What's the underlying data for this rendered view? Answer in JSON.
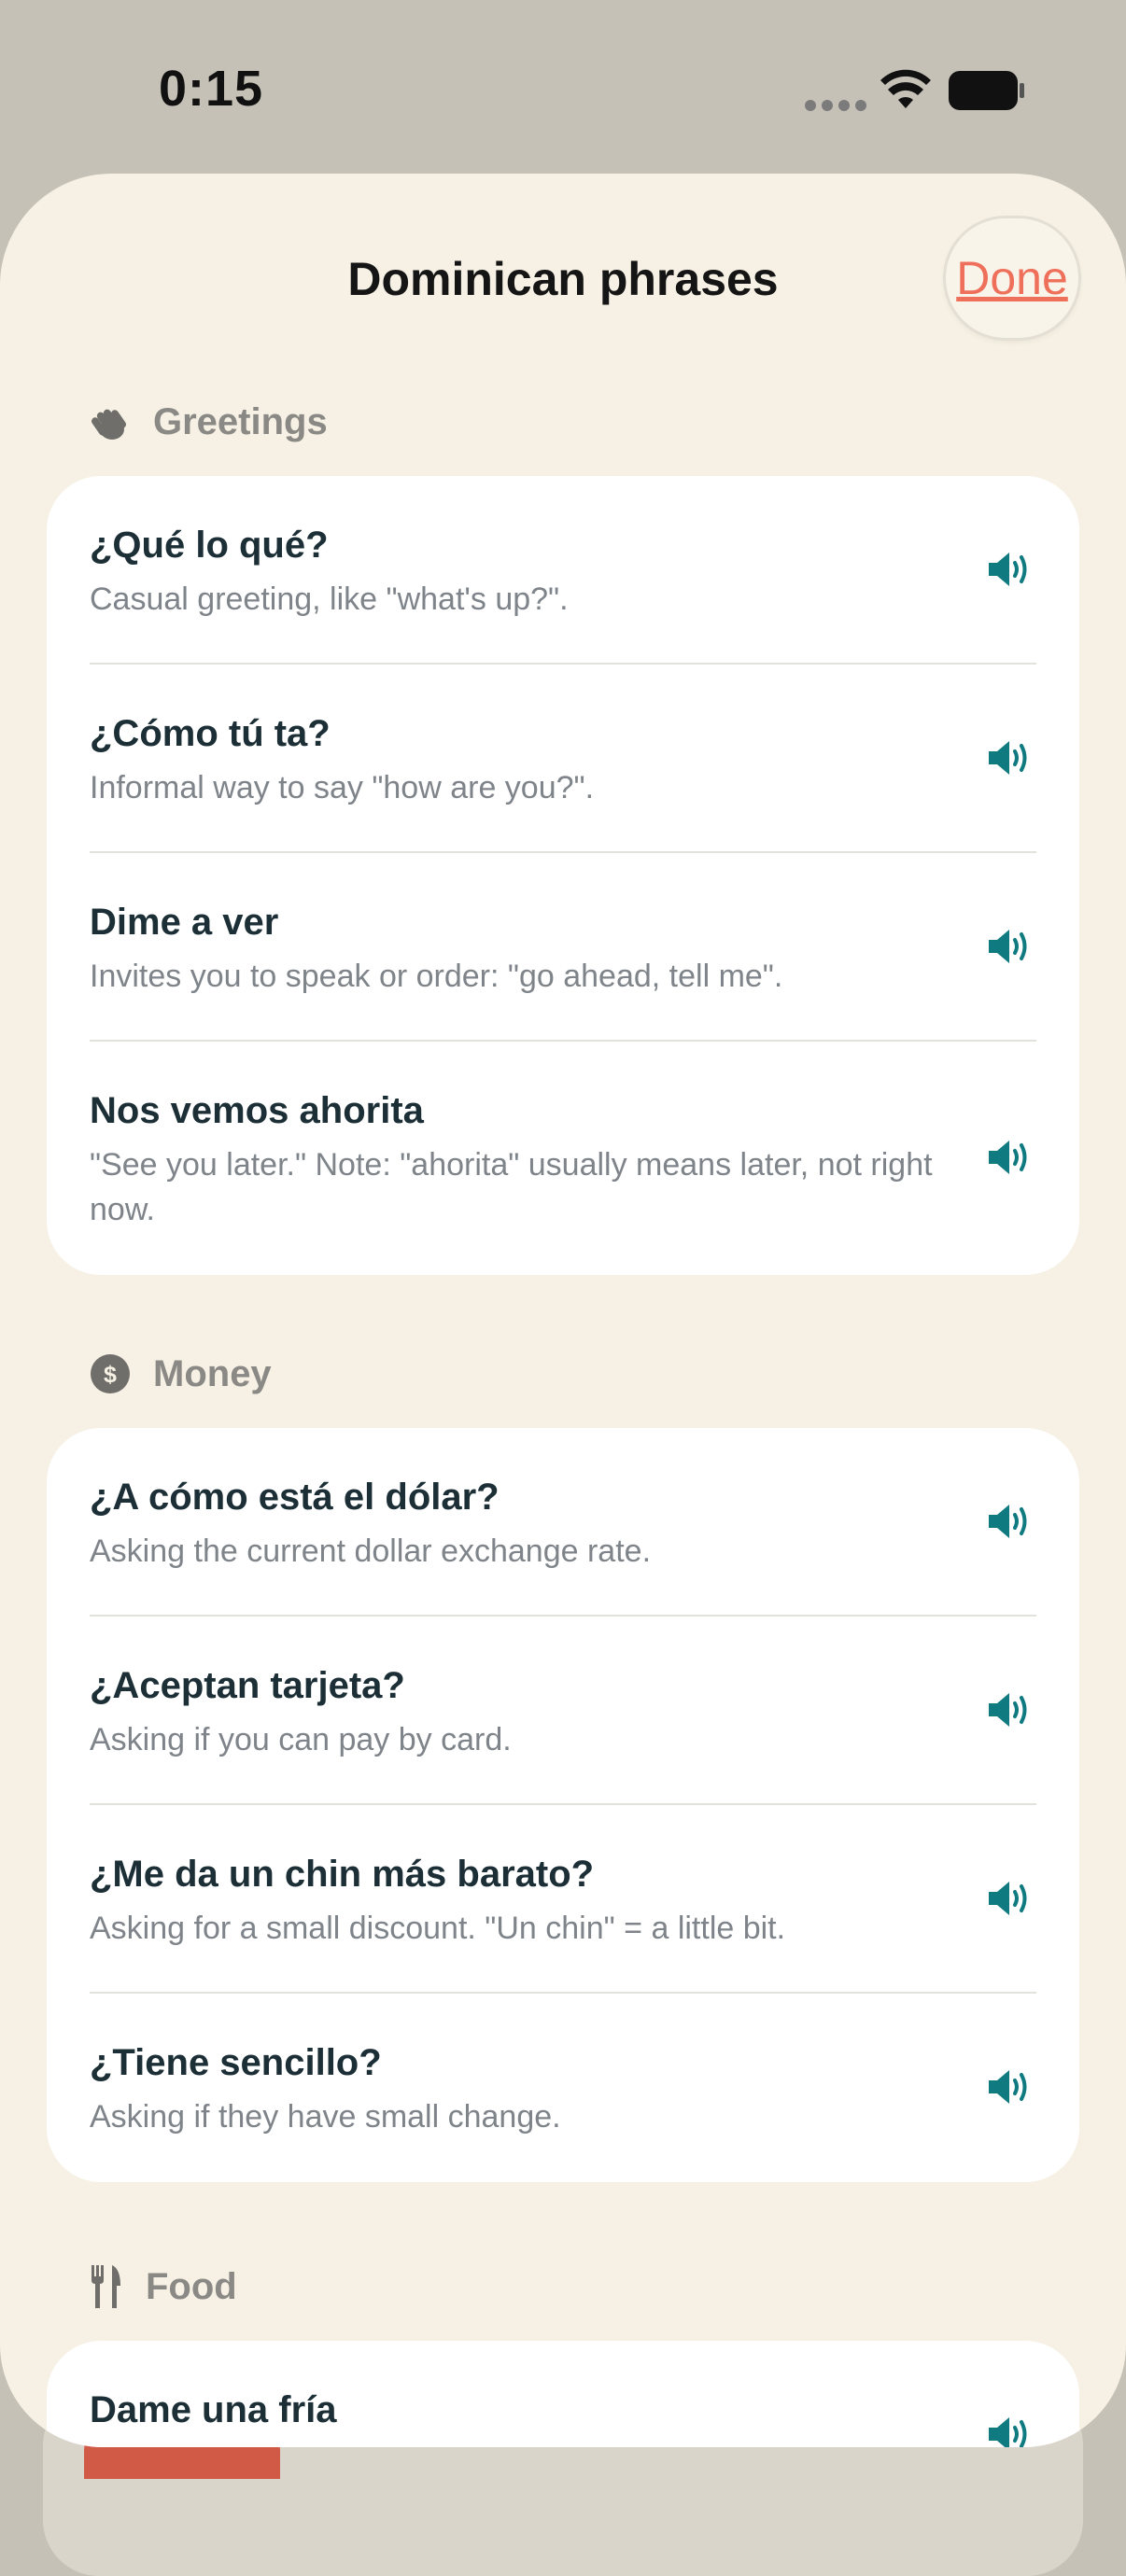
{
  "status": {
    "time": "0:15"
  },
  "sheet": {
    "title": "Dominican phrases",
    "done_label": "Done"
  },
  "colors": {
    "accent": "#0f7a80",
    "done": "#ee6f5a",
    "background": "#f6f1e4"
  },
  "sections": [
    {
      "icon": "waving-hand-icon",
      "title": "Greetings",
      "phrases": [
        {
          "phrase": "¿Qué lo qué?",
          "gloss": "Casual greeting, like \"what's up?\"."
        },
        {
          "phrase": "¿Cómo tú ta?",
          "gloss": "Informal way to say \"how are you?\"."
        },
        {
          "phrase": "Dime a ver",
          "gloss": "Invites you to speak or order: \"go ahead, tell me\"."
        },
        {
          "phrase": "Nos vemos ahorita",
          "gloss": "\"See you later.\" Note: \"ahorita\" usually means later, not right now."
        }
      ]
    },
    {
      "icon": "dollar-circle-icon",
      "title": "Money",
      "phrases": [
        {
          "phrase": "¿A cómo está el dólar?",
          "gloss": "Asking the current dollar exchange rate."
        },
        {
          "phrase": "¿Aceptan tarjeta?",
          "gloss": "Asking if you can pay by card."
        },
        {
          "phrase": "¿Me da un chin más barato?",
          "gloss": "Asking for a small discount. \"Un chin\" = a little bit."
        },
        {
          "phrase": "¿Tiene sencillo?",
          "gloss": "Asking if they have small change."
        }
      ]
    },
    {
      "icon": "fork-knife-icon",
      "title": "Food",
      "phrases": [
        {
          "phrase": "Dame una fría",
          "gloss": ""
        }
      ]
    }
  ]
}
